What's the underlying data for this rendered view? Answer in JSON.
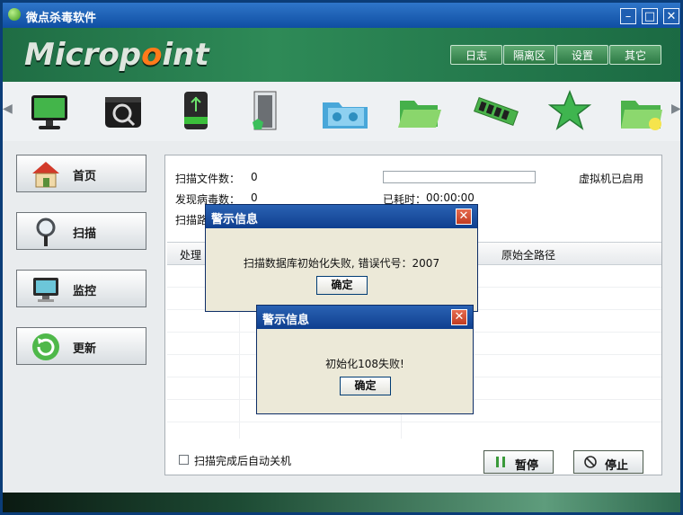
{
  "window": {
    "title": "微点杀毒软件",
    "logo_text": "Micropoint",
    "controls": {
      "minimize": "–",
      "maximize": "□",
      "close": "✕"
    }
  },
  "top_nav": [
    "日志",
    "隔离区",
    "设置",
    "其它"
  ],
  "toolbar": {
    "left_arrow": "◀",
    "right_arrow": "▶",
    "icons": [
      "monitor-icon",
      "disk-search-icon",
      "usb-drive-icon",
      "door-exit-icon",
      "folder-network-icon",
      "folder-open-icon",
      "memory-chip-icon",
      "star-icon",
      "folder-star-icon"
    ]
  },
  "sidebar": [
    {
      "label": "首页",
      "icon": "home-icon"
    },
    {
      "label": "扫描",
      "icon": "magnifier-icon"
    },
    {
      "label": "监控",
      "icon": "monitor-icon"
    },
    {
      "label": "更新",
      "icon": "refresh-icon"
    }
  ],
  "scan": {
    "files_label": "扫描文件数：",
    "files_value": "0",
    "virus_label": "发现病毒数：",
    "virus_value": "0",
    "path_label": "扫描路",
    "elapsed_label": "已耗时：",
    "elapsed_value": "00:00:00",
    "vm_status": "虚拟机已启用",
    "progress": 0
  },
  "table": {
    "columns": [
      "处理",
      "原始全路径"
    ]
  },
  "options": {
    "auto_shutdown_label": "扫描完成后自动关机",
    "auto_shutdown_checked": false
  },
  "actions": {
    "pause_label": "暂停",
    "stop_label": "停止"
  },
  "dialogs": [
    {
      "title": "警示信息",
      "message": "扫描数据库初始化失败, 错误代号：2007",
      "ok_label": "确定"
    },
    {
      "title": "警示信息",
      "message": "初始化108失败!",
      "ok_label": "确定"
    }
  ]
}
